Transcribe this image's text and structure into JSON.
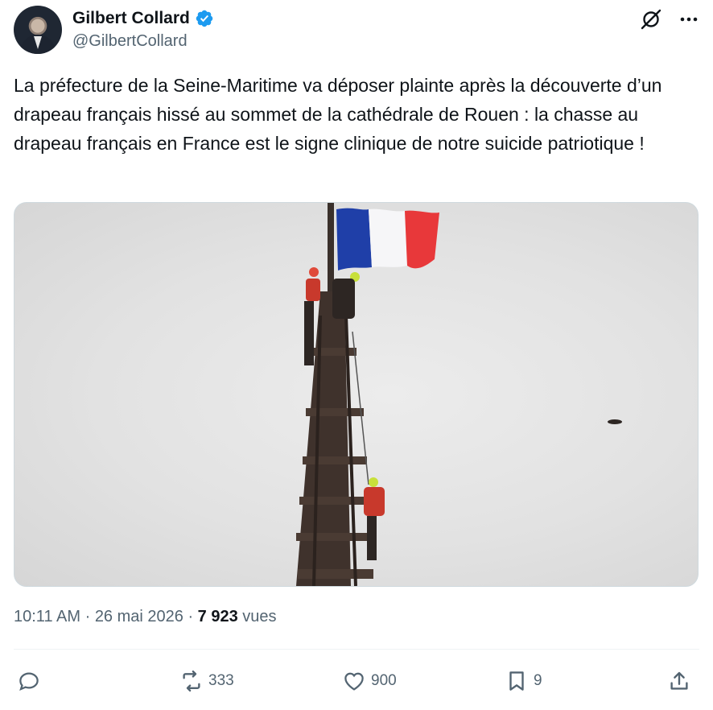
{
  "author": {
    "display_name": "Gilbert Collard",
    "handle": "@GilbertCollard",
    "verified": true,
    "verified_color": "#1d9bf0"
  },
  "tweet": {
    "text": "La préfecture de la Seine-Maritime va déposer plainte après la découverte d’un drapeau français hissé au sommet de la cathédrale de Rouen : la chasse au drapeau français en France est le signe clinique de notre suicide patriotique !"
  },
  "meta": {
    "time": "10:11 AM",
    "separator": " · ",
    "date": "26 mai 2026",
    "views_count": "7 923",
    "views_label": "vues"
  },
  "actions": {
    "reply": {
      "icon": "reply-icon",
      "count": ""
    },
    "retweet": {
      "icon": "retweet-icon",
      "count": "333"
    },
    "like": {
      "icon": "heart-icon",
      "count": "900"
    },
    "bookmark": {
      "icon": "bookmark-icon",
      "count": "9"
    },
    "share": {
      "icon": "share-icon",
      "count": ""
    }
  },
  "header_icons": [
    "grok-icon",
    "more-icon"
  ],
  "colors": {
    "text": "#0f1419",
    "secondary": "#536471",
    "flag_blue": "#1f3fa8",
    "flag_white": "#ffffff",
    "flag_red": "#e8383a"
  }
}
